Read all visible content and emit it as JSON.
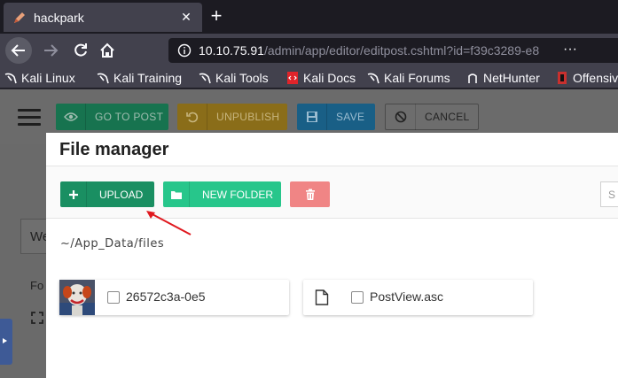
{
  "browser": {
    "tab_title": "hackpark",
    "tab_close": "✕",
    "new_tab": "+",
    "url_host": "10.10.75.91",
    "url_path": "/admin/app/editor/editpost.cshtml?id=f39c3289-e8",
    "url_overflow": "···"
  },
  "bookmarks": [
    {
      "label": "Kali Linux",
      "icon": "kali-dragon-icon"
    },
    {
      "label": "Kali Training",
      "icon": "kali-dragon-icon"
    },
    {
      "label": "Kali Tools",
      "icon": "kali-dragon-icon"
    },
    {
      "label": "Kali Docs",
      "icon": "kali-docs-icon"
    },
    {
      "label": "Kali Forums",
      "icon": "kali-dragon-icon"
    },
    {
      "label": "NetHunter",
      "icon": "nethunter-icon"
    },
    {
      "label": "Offensiv",
      "icon": "offsec-icon"
    }
  ],
  "editor_toolbar": {
    "goto_post": "GO TO POST",
    "unpublish": "UNPUBLISH",
    "save": "SAVE",
    "cancel": "CANCEL"
  },
  "left_panel": {
    "title_fragment": "We",
    "label_fragment": "Fo"
  },
  "file_manager": {
    "title": "File manager",
    "upload": "UPLOAD",
    "new_folder": "NEW FOLDER",
    "search_placeholder": "S",
    "path": "~/App_Data/files",
    "files": [
      {
        "name": "26572c3a-0e5",
        "type": "image"
      },
      {
        "name": "PostView.asc",
        "type": "document"
      }
    ]
  },
  "colors": {
    "upload": "#1a8f62",
    "new_folder": "#27c68b",
    "delete": "#f08585",
    "annotation_arrow": "#e0191f"
  }
}
